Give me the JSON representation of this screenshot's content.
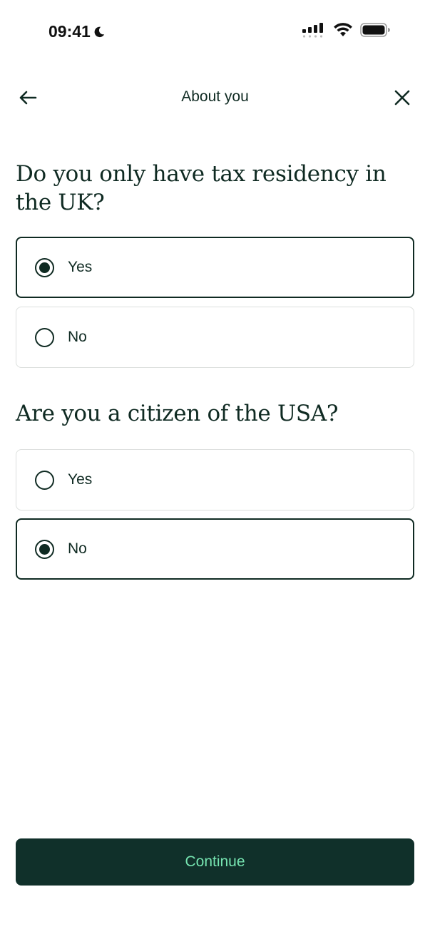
{
  "status_bar": {
    "time": "09:41",
    "icons": [
      "moon-icon",
      "signal-icon",
      "wifi-icon",
      "battery-icon"
    ]
  },
  "nav": {
    "title": "About you",
    "back_icon": "arrow-left-icon",
    "close_icon": "close-icon"
  },
  "questions": [
    {
      "text": "Do you only have tax residency in the UK?",
      "options": [
        {
          "label": "Yes",
          "selected": true
        },
        {
          "label": "No",
          "selected": false
        }
      ]
    },
    {
      "text": "Are you a citizen of the USA?",
      "options": [
        {
          "label": "Yes",
          "selected": false
        },
        {
          "label": "No",
          "selected": true
        }
      ]
    }
  ],
  "footer": {
    "continue_label": "Continue"
  },
  "colors": {
    "primary_dark": "#10302a",
    "accent_green": "#76e5b1",
    "text": "#0f2a22",
    "border": "#dcdfdd"
  }
}
